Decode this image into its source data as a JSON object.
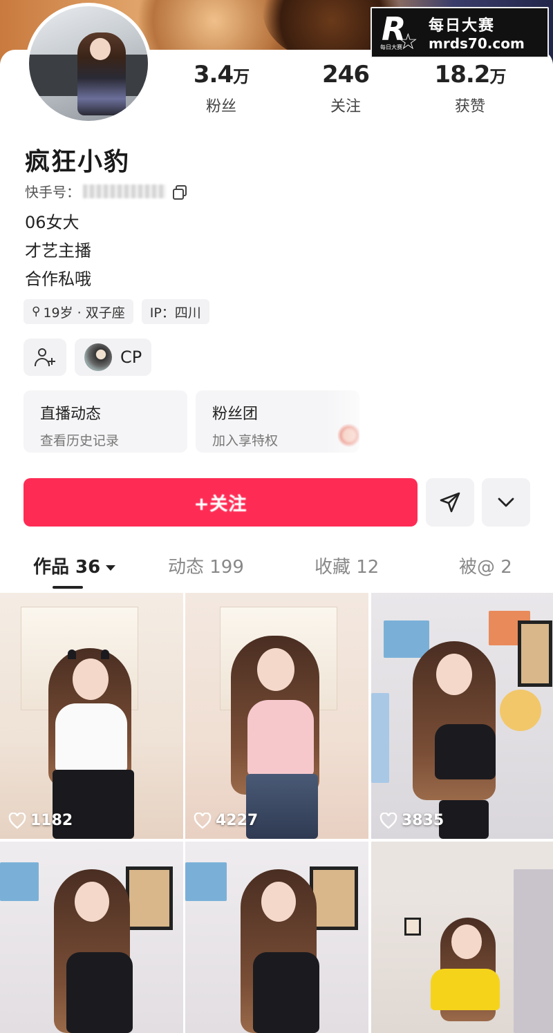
{
  "watermark": {
    "logo_letter": "R",
    "logo_small": "每日大赛",
    "cn": "每日大赛",
    "url": "mrds70.com"
  },
  "profile": {
    "name": "疯狂小豹",
    "kuaishou_id_label": "快手号：",
    "bio": [
      "06女大",
      "才艺主播",
      "合作私哦"
    ],
    "tags": {
      "age": "19岁 · 双子座",
      "ip": "IP：四川"
    }
  },
  "stats": [
    {
      "value": "3.4",
      "unit": "万",
      "label": "粉丝"
    },
    {
      "value": "246",
      "unit": "",
      "label": "关注"
    },
    {
      "value": "18.2",
      "unit": "万",
      "label": "获赞"
    }
  ],
  "chips": {
    "cp_label": "CP"
  },
  "panels": [
    {
      "title": "直播动态",
      "subtitle": "查看历史记录"
    },
    {
      "title": "粉丝团",
      "subtitle": "加入享特权"
    }
  ],
  "follow_button": {
    "label": "+关注"
  },
  "tabs": [
    {
      "label": "作品 36"
    },
    {
      "label": "动态 199"
    },
    {
      "label": "收藏 12"
    },
    {
      "label": "被@ 2"
    }
  ],
  "videos": [
    {
      "likes": "1182"
    },
    {
      "likes": "4227"
    },
    {
      "likes": "3835"
    },
    {
      "likes": ""
    },
    {
      "likes": ""
    },
    {
      "likes": ""
    }
  ],
  "colors": {
    "accent": "#fe2c55",
    "panel_bg": "#f5f5f7",
    "chip_bg": "#f2f2f4"
  },
  "icons": {
    "copy": "copy-icon",
    "location": "location-pin-icon",
    "add_user": "user-plus-icon",
    "share": "paper-plane-icon",
    "more": "chevron-down-icon",
    "like": "heart-outline-icon"
  }
}
